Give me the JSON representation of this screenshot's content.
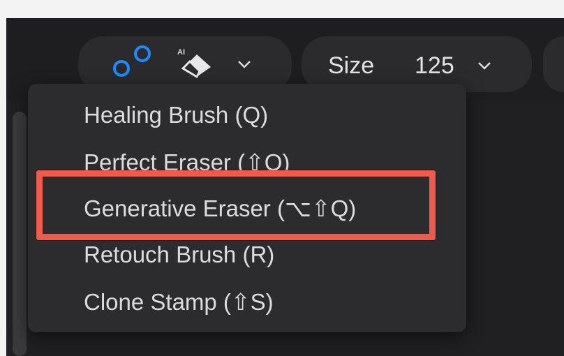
{
  "toolbar": {
    "tool_icon": "nodes-circles-icon",
    "eraser_icon": "ai-eraser-icon",
    "eraser_badge": "AI",
    "tool_dropdown_icon": "chevron-down-icon",
    "size_label": "Size",
    "size_value": "125",
    "size_dropdown_icon": "chevron-down-icon"
  },
  "menu": {
    "items": [
      {
        "label": "Healing Brush (Q)"
      },
      {
        "label": "Perfect Eraser (⇧Q)"
      },
      {
        "label": "Generative Eraser (⌥⇧Q)",
        "highlighted": true
      },
      {
        "label": "Retouch Brush (R)"
      },
      {
        "label": "Clone Stamp (⇧S)"
      }
    ]
  },
  "colors": {
    "accent_blue": "#1a8cff",
    "highlight_red": "#f05a4a",
    "menu_bg": "#2c2c2f",
    "text": "#dcdcdc"
  }
}
